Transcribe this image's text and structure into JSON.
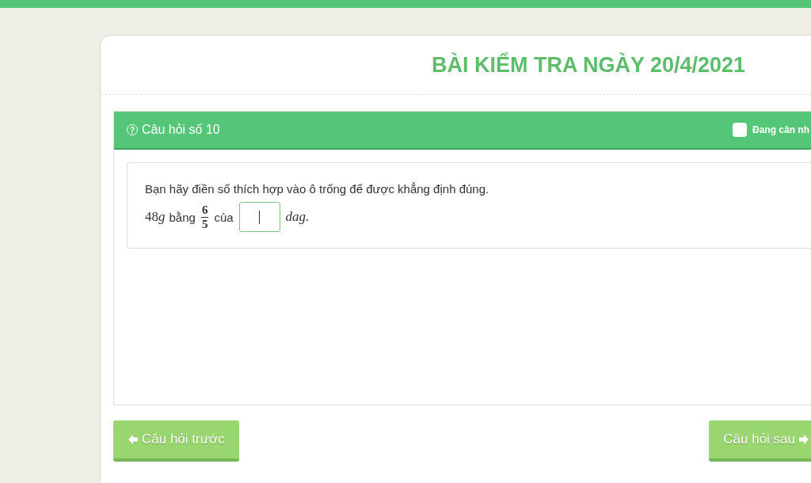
{
  "page_title": "BÀI KIỂM TRA NGÀY 20/4/2021",
  "question": {
    "icon": "?",
    "label": "Câu hỏi số 10",
    "flag": {
      "label": "Đang cân nh",
      "checked": false
    }
  },
  "prompt": "Bạn hãy điền số thích hợp vào ô trống để được khẳng định đúng.",
  "equation": [
    {
      "kind": "math",
      "text": "48"
    },
    {
      "kind": "math-italic",
      "text": "g"
    },
    {
      "kind": "text",
      "text": "bằng"
    },
    {
      "kind": "fraction",
      "numerator": "6",
      "denominator": "5"
    },
    {
      "kind": "text",
      "text": "của"
    },
    {
      "kind": "blank"
    },
    {
      "kind": "math-italic",
      "text": "dag."
    }
  ],
  "buttons": {
    "previous": "Câu hỏi trước",
    "next": "Câu hỏi sau"
  }
}
